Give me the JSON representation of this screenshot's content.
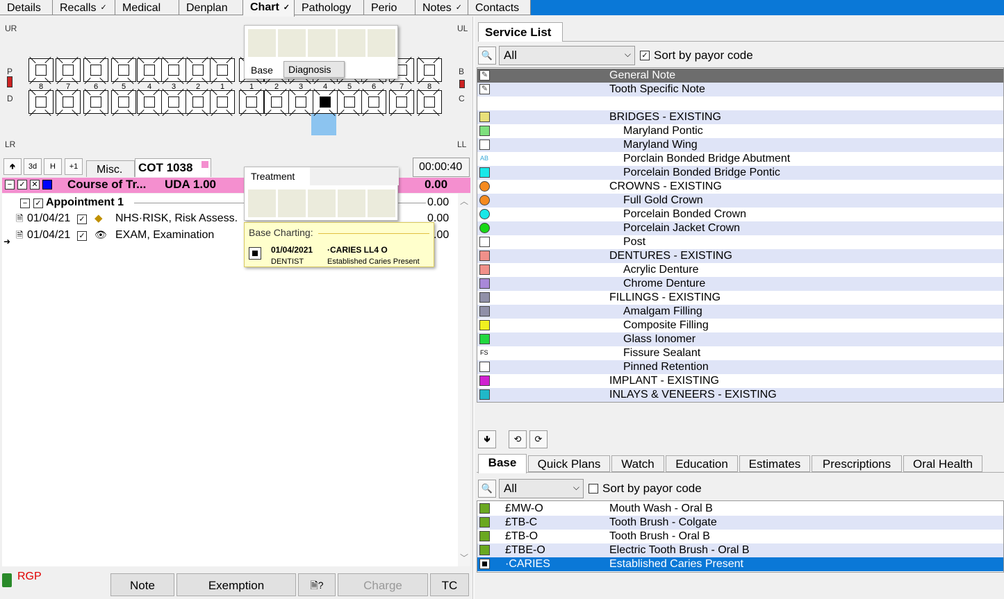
{
  "top_tabs": [
    {
      "label": "Details"
    },
    {
      "label": "Recalls",
      "check": "✓"
    },
    {
      "label": "Medical"
    },
    {
      "label": "Denplan"
    },
    {
      "label": "Chart",
      "check": "✓"
    },
    {
      "label": "Pathology"
    },
    {
      "label": "Perio"
    },
    {
      "label": "Notes",
      "check": "✓"
    },
    {
      "label": "Contacts"
    }
  ],
  "chart": {
    "quadrants": {
      "ur": "UR",
      "ul": "UL",
      "lr": "LR",
      "ll": "LL"
    },
    "side_left": [
      "P",
      "D"
    ],
    "side_right": [
      "B",
      "C"
    ],
    "tooth_numbers": [
      "8",
      "7",
      "6",
      "5",
      "4",
      "3",
      "2",
      "1",
      "1",
      "2",
      "3",
      "4",
      "5",
      "6",
      "7",
      "8"
    ]
  },
  "popup_base": {
    "tab_base": "Base",
    "tab_diagnosis": "Diagnosis"
  },
  "popup_treatment": {
    "title": "Treatment"
  },
  "tooltip": {
    "title": "Base Charting:",
    "date": "01/04/2021",
    "code": "·CARIES  LL4  O",
    "role": "DENTIST",
    "desc": "Established Caries Present"
  },
  "treatment": {
    "buttons": [
      "🢁",
      "3d",
      "H",
      "+1"
    ],
    "misc_tab": "Misc.",
    "cot": "COT 1038",
    "timer": "00:00:40",
    "course_label": "Course of Tr...",
    "uda": "UDA 1.00",
    "course_amount": "0.00",
    "appointment": "Appointment 1",
    "appointment_amount": "0.00",
    "items": [
      {
        "date": "01/04/21",
        "desc": "NHS·RISK, Risk Assess.",
        "amount": "0.00"
      },
      {
        "date": "01/04/21",
        "desc": "EXAM, Examination",
        "amount": ".00"
      }
    ]
  },
  "bottom_buttons": {
    "rgp": "RGP",
    "note": "Note",
    "exemption": "Exemption",
    "charge": "Charge",
    "tc": "TC"
  },
  "service_list": {
    "tab": "Service List",
    "filter": "All",
    "sort_label": "Sort by payor code",
    "rows": [
      {
        "label": "General Note",
        "indent": false,
        "icon": "pencil-icon",
        "color": "#ffffff"
      },
      {
        "label": "Tooth Specific Note",
        "indent": false,
        "icon": "pencil-icon",
        "color": "#ffffff"
      },
      {
        "label": "",
        "indent": false,
        "icon": "blank-icon",
        "color": "#ffffff"
      },
      {
        "label": "BRIDGES - EXISTING",
        "indent": false,
        "icon": "square-icon",
        "color": "#e8e07a"
      },
      {
        "label": "Maryland Pontic",
        "indent": true,
        "icon": "square-icon",
        "color": "#7ee07e"
      },
      {
        "label": "Maryland Wing",
        "indent": true,
        "icon": "tooth-box-icon",
        "color": "#ffffff"
      },
      {
        "label": "Porclain Bonded Bridge Abutment",
        "indent": true,
        "icon": "ab-icon",
        "color": "#ffffff"
      },
      {
        "label": "Porcelain Bonded Bridge Pontic",
        "indent": true,
        "icon": "square-icon",
        "color": "#18e8e8"
      },
      {
        "label": "CROWNS - EXISTING",
        "indent": false,
        "icon": "circle-icon",
        "color": "#f58a1f"
      },
      {
        "label": "Full Gold Crown",
        "indent": true,
        "icon": "circle-icon",
        "color": "#f58a1f"
      },
      {
        "label": "Porcelain Bonded Crown",
        "indent": true,
        "icon": "circle-icon",
        "color": "#18e8e8"
      },
      {
        "label": "Porcelain Jacket Crown",
        "indent": true,
        "icon": "circle-icon",
        "color": "#18d818"
      },
      {
        "label": "Post",
        "indent": true,
        "icon": "post-icon",
        "color": "#ffffff"
      },
      {
        "label": "DENTURES - EXISTING",
        "indent": false,
        "icon": "square-icon",
        "color": "#f0908a"
      },
      {
        "label": "Acrylic Denture",
        "indent": true,
        "icon": "square-icon",
        "color": "#f0908a"
      },
      {
        "label": "Chrome Denture",
        "indent": true,
        "icon": "square-icon",
        "color": "#a888d8"
      },
      {
        "label": "FILLINGS - EXISTING",
        "indent": false,
        "icon": "filling-icon",
        "color": "#9090a8"
      },
      {
        "label": "Amalgam Filling",
        "indent": true,
        "icon": "filling-icon",
        "color": "#9090a8"
      },
      {
        "label": "Composite Filling",
        "indent": true,
        "icon": "filling-icon",
        "color": "#f0f020"
      },
      {
        "label": "Glass Ionomer",
        "indent": true,
        "icon": "filling-icon",
        "color": "#20d840"
      },
      {
        "label": "Fissure Sealant",
        "indent": true,
        "icon": "fs-icon",
        "color": "#ffffff"
      },
      {
        "label": "Pinned Retention",
        "indent": true,
        "icon": "pin-icon",
        "color": "#ffffff"
      },
      {
        "label": "IMPLANT - EXISTING",
        "indent": false,
        "icon": "implant-icon",
        "color": "#d020d0"
      },
      {
        "label": "INLAYS & VENEERS - EXISTING",
        "indent": false,
        "icon": "filling-icon",
        "color": "#20b8c8"
      }
    ]
  },
  "bottom_tabs": [
    "Base",
    "Quick Plans",
    "Watch",
    "Education",
    "Estimates",
    "Prescriptions",
    "Oral Health"
  ],
  "plan_list": {
    "filter": "All",
    "sort_label": "Sort by payor code",
    "rows": [
      {
        "code": "£MW-O",
        "desc": "Mouth Wash - Oral B",
        "icon": "mouthwash-icon"
      },
      {
        "code": "£TB-C",
        "desc": "Tooth Brush - Colgate",
        "icon": "toothbrush-icon"
      },
      {
        "code": "£TB-O",
        "desc": "Tooth Brush - Oral B",
        "icon": "toothbrush-icon"
      },
      {
        "code": "£TBE-O",
        "desc": "Electric Tooth Brush - Oral B",
        "icon": "electric-toothbrush-icon"
      },
      {
        "code": "·CARIES",
        "desc": "Established Caries Present",
        "icon": "caries-icon"
      }
    ]
  }
}
